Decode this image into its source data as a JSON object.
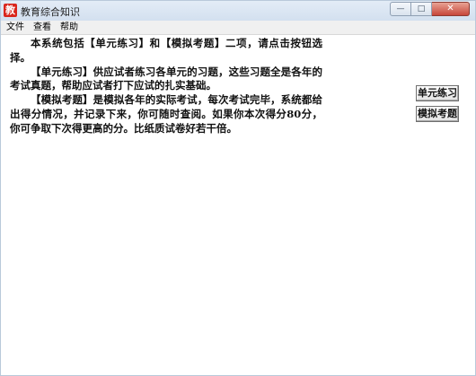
{
  "window": {
    "title": "教育综合知识",
    "icon_glyph": "教",
    "icon_color": "#d9261c",
    "caption_buttons": {
      "minimize": "—",
      "maximize": "□",
      "close": "✕"
    }
  },
  "menu": {
    "items": [
      "文件",
      "查看",
      "帮助"
    ]
  },
  "intro": {
    "paragraphs": [
      "本系统包括【单元练习】和【模拟考题】二项，请点击按钮选择。",
      "【单元练习】供应试者练习各单元的习题，这些习题全是各年的考试真题，帮助应试者打下应试的扎实基础。",
      "【模拟考题】是模拟各年的实际考试，每次考试完毕，系统都给出得分情况，并记录下来，你可随时查阅。如果你本次得分80分，你可争取下次得更高的分。比纸质试卷好若干倍。"
    ]
  },
  "buttons": {
    "unit_practice": "单元练习",
    "mock_exam": "模拟考题"
  }
}
